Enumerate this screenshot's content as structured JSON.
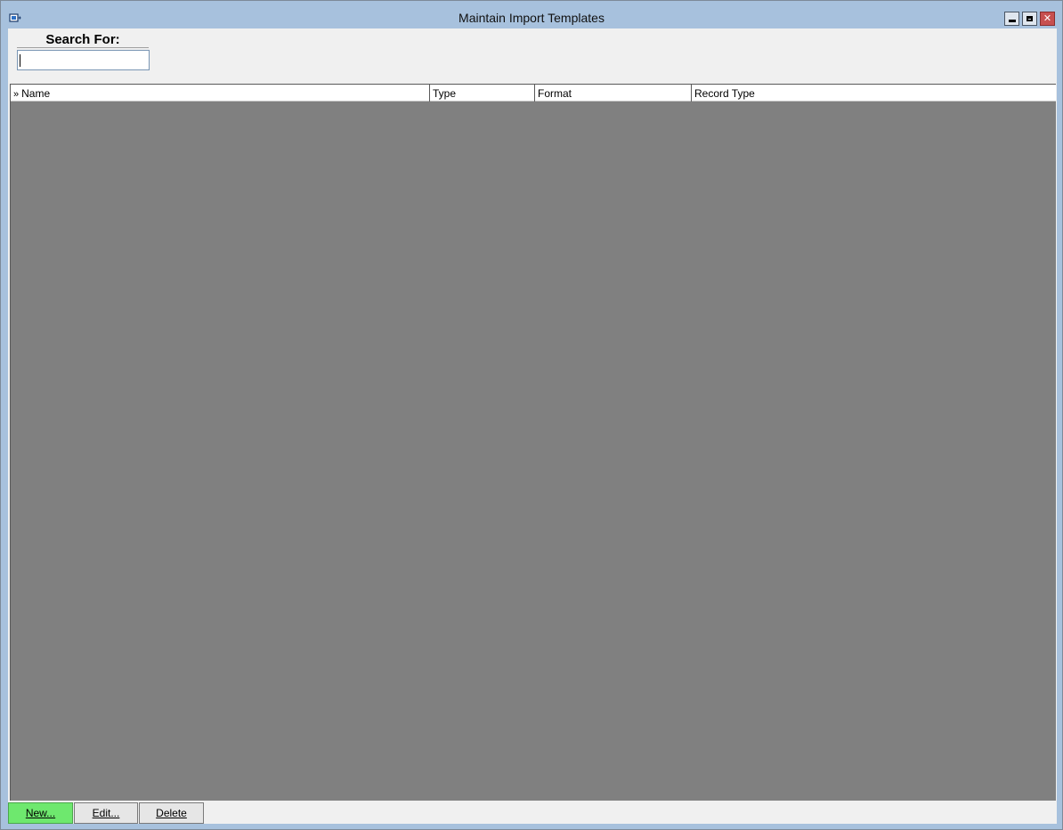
{
  "window": {
    "title": "Maintain Import Templates",
    "icon": "app-icon",
    "controls": [
      "minimize-icon",
      "maximize-icon",
      "close-icon"
    ],
    "close_glyph": "✕"
  },
  "search": {
    "label": "Search For:",
    "value": ""
  },
  "grid": {
    "sort_indicator": "»",
    "columns": [
      {
        "label": "Name"
      },
      {
        "label": "Type"
      },
      {
        "label": "Format"
      },
      {
        "label": "Record Type"
      }
    ],
    "rows": []
  },
  "buttons": {
    "new": "New...",
    "edit": "Edit...",
    "delete": "Delete"
  },
  "colors": {
    "titlebar": "#a7c1dd",
    "new_button": "#6ee86e",
    "grid_background": "#808080",
    "close_button": "#c75050"
  }
}
